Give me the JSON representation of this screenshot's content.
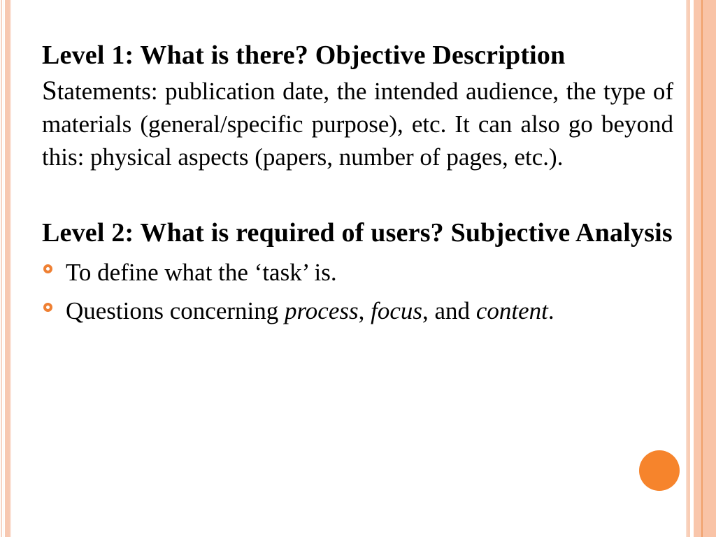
{
  "slide": {
    "background_color": "#ffffff",
    "accent_color": "#f6842c",
    "bullet_color": "#ef8033",
    "stripe_color": "#f9c6ab",
    "text_color": "#000000"
  },
  "heading1": {
    "text": "Level 1: What is there? Objective Description"
  },
  "paragraph1": {
    "first_letter": "S",
    "rest": "tatements: publication date, the intended audience, the type of materials (general/specific purpose), etc. It can also go beyond this: physical aspects (papers, number of pages, etc.)."
  },
  "heading2": {
    "text": "Level 2: What is required of users? Subjective Analysis"
  },
  "bullets": [
    {
      "marker": "hollow-circle-bullet",
      "segments": [
        {
          "text": "To define what the ‘task’ is.",
          "style": "normal"
        }
      ]
    },
    {
      "marker": "hollow-circle-bullet",
      "segments": [
        {
          "text": "Questions concerning ",
          "style": "normal"
        },
        {
          "text": "process",
          "style": "italic"
        },
        {
          "text": ", ",
          "style": "normal"
        },
        {
          "text": "focus",
          "style": "italic"
        },
        {
          "text": ", and ",
          "style": "normal"
        },
        {
          "text": "content",
          "style": "italic"
        },
        {
          "text": ".",
          "style": "normal"
        }
      ]
    }
  ],
  "bullet_text": {
    "item0_full": "To define what the ‘task’ is.",
    "item1_pre": "Questions concerning ",
    "item1_em1": "process",
    "item1_mid1": ", ",
    "item1_em2": "focus",
    "item1_mid2": ", and ",
    "item1_em3": "content",
    "item1_post": "."
  },
  "decoration": {
    "accent_dot_name": "orange-circle-decoration"
  }
}
